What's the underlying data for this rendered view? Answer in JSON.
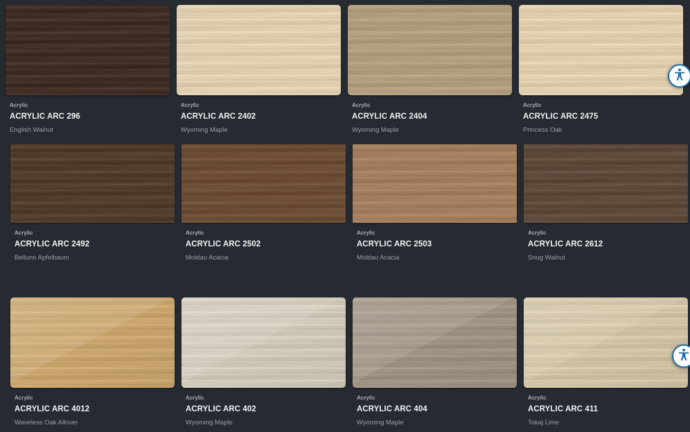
{
  "products": [
    {
      "category": "Acrylic",
      "code": "ACRYLIC ARC 296",
      "name": "English Walnut",
      "color": "#3c2820",
      "gloss": false
    },
    {
      "category": "Acrylic",
      "code": "ACRYLIC ARC 2402",
      "name": "Wyoming Maple",
      "color": "#ead8b6",
      "gloss": false
    },
    {
      "category": "Acrylic",
      "code": "ACRYLIC ARC 2404",
      "name": "Wyoming Maple",
      "color": "#b6a27e",
      "gloss": false
    },
    {
      "category": "Acrylic",
      "code": "ACRYLIC ARC 2475",
      "name": "Princess Oak",
      "color": "#ead7b4",
      "gloss": false
    },
    {
      "category": "Acrylic",
      "code": "ACRYLIC ARC 2492",
      "name": "Belluno Apfelbaum",
      "color": "#4f3826",
      "gloss": false
    },
    {
      "category": "Acrylic",
      "code": "ACRYLIC ARC 2502",
      "name": "Moldau Acacia",
      "color": "#6c4a32",
      "gloss": false
    },
    {
      "category": "Acrylic",
      "code": "ACRYLIC ARC 2503",
      "name": "Moldau Acacia",
      "color": "#a8805e",
      "gloss": false
    },
    {
      "category": "Acrylic",
      "code": "ACRYLIC ARC 2612",
      "name": "Snug Walnut",
      "color": "#5c4636",
      "gloss": false
    },
    {
      "category": "Acrylic",
      "code": "ACRYLIC ARC 4012",
      "name": "Waveless Oak Allover",
      "color": "#d2aa6c",
      "gloss": true
    },
    {
      "category": "Acrylic",
      "code": "ACRYLIC ARC 402",
      "name": "Wyoming Maple",
      "color": "#d9d2c0",
      "gloss": true
    },
    {
      "category": "Acrylic",
      "code": "ACRYLIC ARC 404",
      "name": "Wyoming Maple",
      "color": "#a39584",
      "gloss": true
    },
    {
      "category": "Acrylic",
      "code": "ACRYLIC ARC 411",
      "name": "Tokaj Lime",
      "color": "#dbcbaa",
      "gloss": true
    }
  ],
  "floating_button_icon": "accessibility-icon"
}
